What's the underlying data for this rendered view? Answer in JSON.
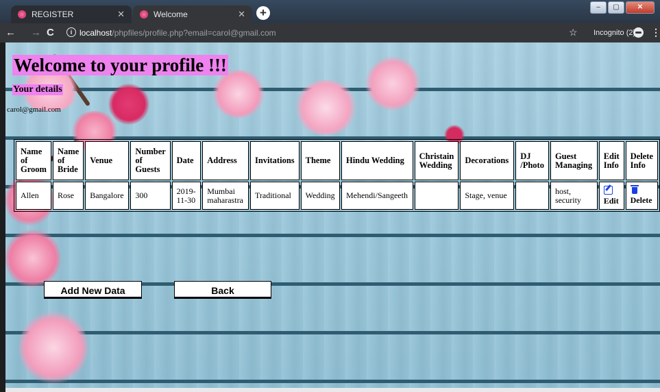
{
  "browser": {
    "tabs": [
      {
        "title": "REGISTER",
        "active": false
      },
      {
        "title": "Welcome",
        "active": true
      }
    ],
    "new_tab_icon": "plus-icon",
    "url_host": "localhost",
    "url_path": "/phpfiles/profile.php?email=carol@gmail.com",
    "incognito_label": "Incognito (2)"
  },
  "page": {
    "heading": "Welcome to your profile !!!",
    "details_label": "Your details",
    "email": "carol@gmail.com"
  },
  "table": {
    "headers": [
      "Name of Groom",
      "Name of Bride",
      "Venue",
      "Number of Guests",
      "Date",
      "Address",
      "Invitations",
      "Theme",
      "Hindu Wedding",
      "Christain Wedding",
      "Decorations",
      "DJ /Photo",
      "Guest Managing",
      "Edit Info",
      "Delete Info"
    ],
    "rows": [
      {
        "groom": "Allen",
        "bride": "Rose",
        "venue": "Bangalore",
        "guests": "300",
        "date": "2019-11-30",
        "address": "Mumbai maharastra",
        "invitations": "Traditional",
        "theme": "Wedding",
        "hindu": "Mehendi/Sangeeth",
        "christian": "",
        "decorations": "Stage, venue",
        "dj": "",
        "guest_managing": "host, security",
        "edit": "Edit",
        "delete": "Delete"
      }
    ]
  },
  "buttons": {
    "add": "Add New Data",
    "back": "Back"
  },
  "colors": {
    "highlight": "#ee82ee",
    "icon_blue": "#1a3ee8"
  }
}
